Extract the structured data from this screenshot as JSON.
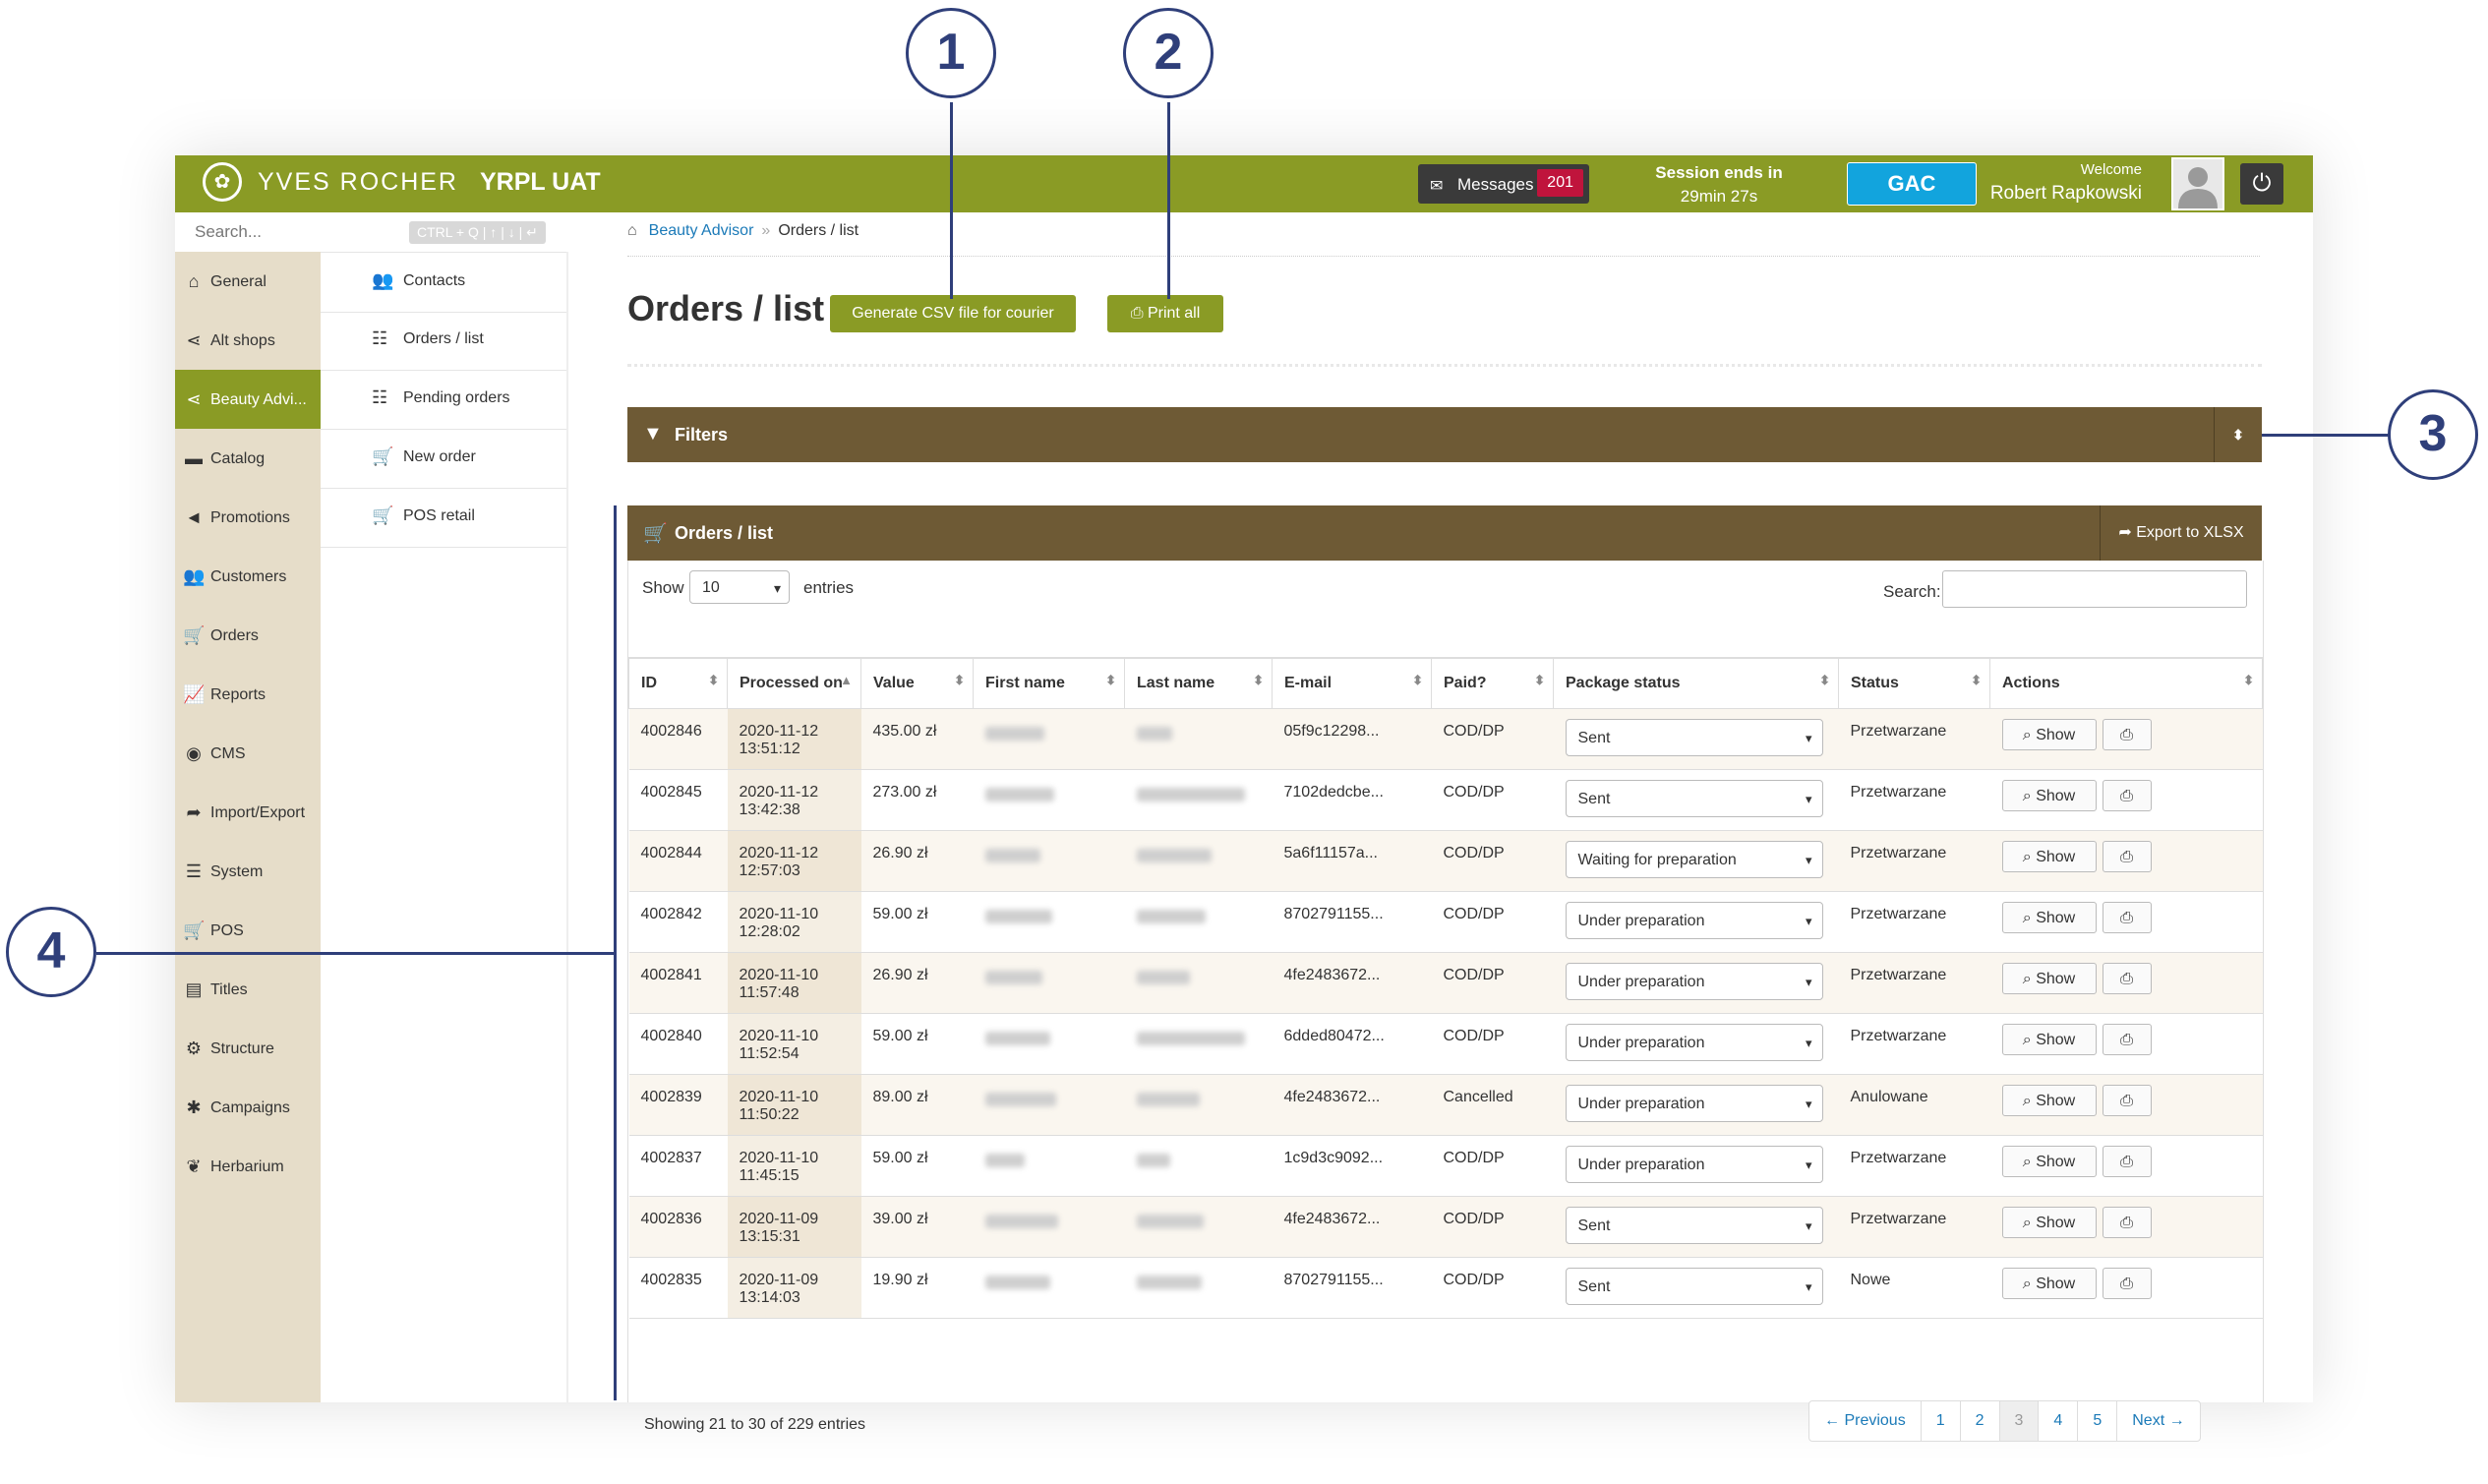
{
  "topbar": {
    "brand": "YVES ROCHER",
    "env": "YRPL UAT",
    "messages_label": "Messages",
    "messages_count": "201",
    "session_line1": "Session ends in",
    "session_line2": "29min 27s",
    "gac_label": "GAC",
    "welcome_label": "Welcome",
    "user_name": "Robert Rapkowski"
  },
  "search": {
    "placeholder": "Search...",
    "shortcut": "CTRL + Q | ↑ | ↓ | ↵"
  },
  "sidebar": {
    "items": [
      {
        "label": "General",
        "icon": "home-icon"
      },
      {
        "label": "Alt shops",
        "icon": "share-icon"
      },
      {
        "label": "Beauty Advi...",
        "icon": "share-icon"
      },
      {
        "label": "Catalog",
        "icon": "folder-icon"
      },
      {
        "label": "Promotions",
        "icon": "megaphone-icon"
      },
      {
        "label": "Customers",
        "icon": "users-icon"
      },
      {
        "label": "Orders",
        "icon": "cart-icon"
      },
      {
        "label": "Reports",
        "icon": "chart-icon"
      },
      {
        "label": "CMS",
        "icon": "globe-icon"
      },
      {
        "label": "Import/Export",
        "icon": "share-arrow-icon"
      },
      {
        "label": "System",
        "icon": "sliders-icon"
      },
      {
        "label": "POS",
        "icon": "cart-icon"
      },
      {
        "label": "Titles",
        "icon": "list-card-icon"
      },
      {
        "label": "Structure",
        "icon": "gear-icon"
      },
      {
        "label": "Campaigns",
        "icon": "asterisk-icon"
      },
      {
        "label": "Herbarium",
        "icon": "leaf-icon"
      }
    ]
  },
  "subnav": {
    "items": [
      {
        "label": "Contacts",
        "icon": "users-icon"
      },
      {
        "label": "Orders / list",
        "icon": "list-icon"
      },
      {
        "label": "Pending orders",
        "icon": "list-icon"
      },
      {
        "label": "New order",
        "icon": "cart-icon"
      },
      {
        "label": "POS retail",
        "icon": "cart-icon"
      }
    ]
  },
  "breadcrumb": {
    "link": "Beauty Advisor",
    "sep": "»",
    "current": "Orders / list"
  },
  "page": {
    "title": "Orders / list",
    "csv_button": "Generate CSV file for courier",
    "print_all_button": "Print all"
  },
  "filters": {
    "label": "Filters"
  },
  "orders_panel": {
    "title": "Orders / list",
    "export_label": "Export to XLSX",
    "show_label": "Show",
    "entries_value": "10",
    "entries_label": "entries",
    "search_label": "Search:",
    "showing_text": "Showing 21 to 30 of 229 entries"
  },
  "table": {
    "columns": [
      "ID",
      "Processed on",
      "Value",
      "First name",
      "Last name",
      "E-mail",
      "Paid?",
      "Package status",
      "Status",
      "Actions"
    ],
    "show_label": "Show",
    "rows": [
      {
        "id": "4002846",
        "processed": "2020-11-12 13:51:12",
        "value": "435.00 zł",
        "email": "05f9c12298...",
        "paid": "COD/DP",
        "package": "Sent",
        "status": "Przetwarzane"
      },
      {
        "id": "4002845",
        "processed": "2020-11-12 13:42:38",
        "value": "273.00 zł",
        "email": "7102dedcbe...",
        "paid": "COD/DP",
        "package": "Sent",
        "status": "Przetwarzane"
      },
      {
        "id": "4002844",
        "processed": "2020-11-12 12:57:03",
        "value": "26.90 zł",
        "email": "5a6f11157a...",
        "paid": "COD/DP",
        "package": "Waiting for preparation",
        "status": "Przetwarzane"
      },
      {
        "id": "4002842",
        "processed": "2020-11-10 12:28:02",
        "value": "59.00 zł",
        "email": "8702791155...",
        "paid": "COD/DP",
        "package": "Under preparation",
        "status": "Przetwarzane"
      },
      {
        "id": "4002841",
        "processed": "2020-11-10 11:57:48",
        "value": "26.90 zł",
        "email": "4fe2483672...",
        "paid": "COD/DP",
        "package": "Under preparation",
        "status": "Przetwarzane"
      },
      {
        "id": "4002840",
        "processed": "2020-11-10 11:52:54",
        "value": "59.00 zł",
        "email": "6dded80472...",
        "paid": "COD/DP",
        "package": "Under preparation",
        "status": "Przetwarzane"
      },
      {
        "id": "4002839",
        "processed": "2020-11-10 11:50:22",
        "value": "89.00 zł",
        "email": "4fe2483672...",
        "paid": "Cancelled",
        "package": "Under preparation",
        "status": "Anulowane"
      },
      {
        "id": "4002837",
        "processed": "2020-11-10 11:45:15",
        "value": "59.00 zł",
        "email": "1c9d3c9092...",
        "paid": "COD/DP",
        "package": "Under preparation",
        "status": "Przetwarzane"
      },
      {
        "id": "4002836",
        "processed": "2020-11-09 13:15:31",
        "value": "39.00 zł",
        "email": "4fe2483672...",
        "paid": "COD/DP",
        "package": "Sent",
        "status": "Przetwarzane"
      },
      {
        "id": "4002835",
        "processed": "2020-11-09 13:14:03",
        "value": "19.90 zł",
        "email": "8702791155...",
        "paid": "COD/DP",
        "package": "Sent",
        "status": "Nowe"
      }
    ]
  },
  "pagination": {
    "prev": "← Previous",
    "pages": [
      "1",
      "2",
      "3",
      "4",
      "5"
    ],
    "next": "Next →"
  },
  "callouts": [
    "1",
    "2",
    "3",
    "4"
  ],
  "colors": {
    "olive": "#8a9b25",
    "brown": "#6e5a35",
    "sidebar": "#e6ddc9",
    "callout": "#2f3f7a",
    "badge": "#c0143c",
    "gac": "#12a4dd"
  }
}
